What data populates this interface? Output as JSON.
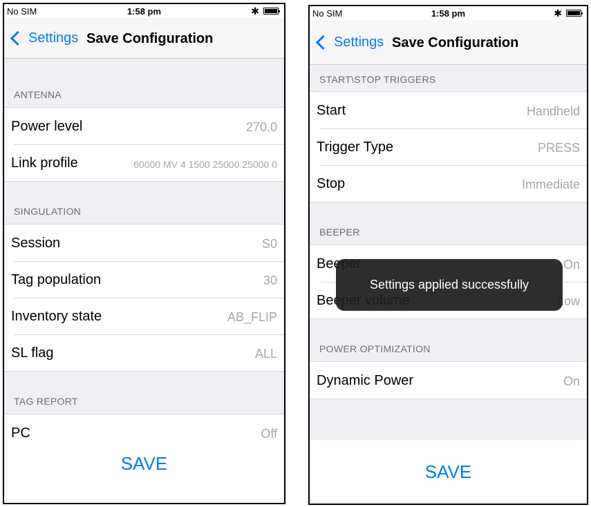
{
  "left": {
    "status": {
      "carrier": "No SIM",
      "time": "1:58 pm"
    },
    "nav": {
      "back": "Settings",
      "title": "Save Configuration"
    },
    "sections": {
      "antenna": {
        "header": "ANTENNA",
        "rows": [
          {
            "label": "Power level",
            "value": "270.0"
          },
          {
            "label": "Link profile",
            "value": "60000 MV 4 1500 25000 25000 0"
          }
        ]
      },
      "singulation": {
        "header": "SINGULATION",
        "rows": [
          {
            "label": "Session",
            "value": "S0"
          },
          {
            "label": "Tag population",
            "value": "30"
          },
          {
            "label": "Inventory state",
            "value": "AB_FLIP"
          },
          {
            "label": "SL flag",
            "value": "ALL"
          }
        ]
      },
      "tagreport": {
        "header": "TAG REPORT",
        "rows": [
          {
            "label": "PC",
            "value": "Off"
          }
        ]
      }
    },
    "save": "SAVE"
  },
  "right": {
    "status": {
      "carrier": "No SIM",
      "time": "1:58 pm"
    },
    "nav": {
      "back": "Settings",
      "title": "Save Configuration"
    },
    "sections": {
      "triggers": {
        "header": "START\\STOP TRIGGERS",
        "rows": [
          {
            "label": "Start",
            "value": "Handheld"
          },
          {
            "label": "Trigger Type",
            "value": "PRESS"
          },
          {
            "label": "Stop",
            "value": "Immediate"
          }
        ]
      },
      "beeper": {
        "header": "BEEPER",
        "rows": [
          {
            "label": "Beeper",
            "value": "On"
          },
          {
            "label": "Beeper volume",
            "value": "Low"
          }
        ]
      },
      "power": {
        "header": "POWER OPTIMIZATION",
        "rows": [
          {
            "label": "Dynamic Power",
            "value": "On"
          }
        ]
      }
    },
    "toast": "Settings applied successfully",
    "save": "SAVE"
  },
  "icons": {
    "back": "chevron-left-icon",
    "bluetooth": "bluetooth-icon",
    "battery": "battery-icon"
  },
  "colors": {
    "accent": "#007aff",
    "background": "#efeff4",
    "value_text": "#a6a6ab",
    "section_text": "#6d6d72"
  }
}
